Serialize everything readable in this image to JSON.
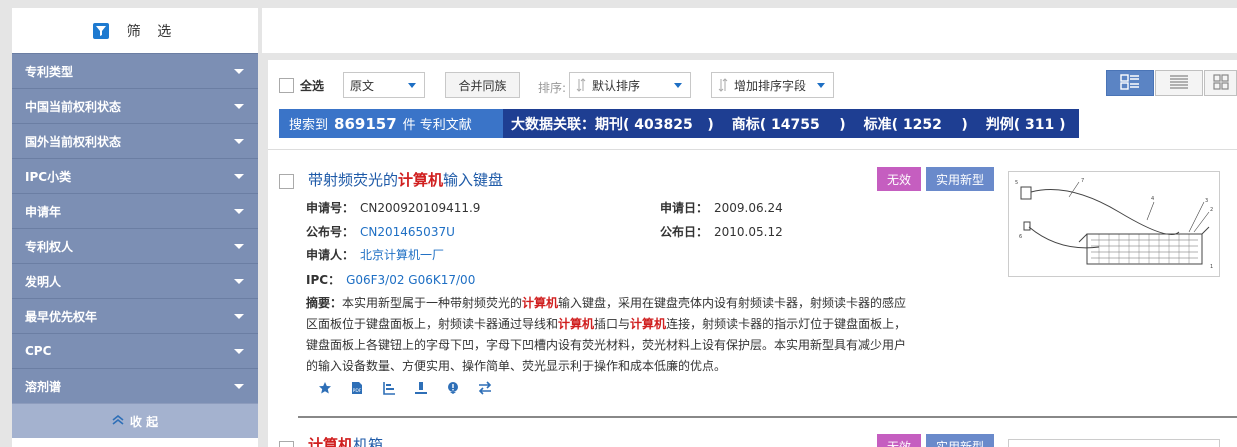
{
  "sidebar": {
    "title": "筛 选",
    "items": [
      {
        "label": "专利类型"
      },
      {
        "label": "中国当前权利状态"
      },
      {
        "label": "国外当前权利状态"
      },
      {
        "label": "IPC小类"
      },
      {
        "label": "申请年"
      },
      {
        "label": "专利权人"
      },
      {
        "label": "发明人"
      },
      {
        "label": "最早优先权年"
      },
      {
        "label": "CPC"
      },
      {
        "label": "溶剂谱"
      }
    ],
    "collapse_label": "收 起"
  },
  "toolbar": {
    "select_all": "全选",
    "text_mode": "原文",
    "merge_family": "合并同族",
    "sort_label": "排序:",
    "sort_value": "默认排序",
    "add_sort_field": "增加排序字段"
  },
  "summary": {
    "prefix": "搜索到",
    "count": "869157",
    "suffix": "件 专利文献",
    "bigdata": "大数据关联：期刊( 403825   )",
    "trademark": "商标( 14755    )",
    "standard": "标准( 1252    )",
    "case": "判例( 311 )"
  },
  "results": [
    {
      "title_pre": "带射频荧光的",
      "title_kw": "计算机",
      "title_post": "输入键盘",
      "status": "无效",
      "type": "实用新型",
      "app_no_label": "申请号：",
      "app_no": "CN200920109411.9",
      "app_date_label": "申请日：",
      "app_date": "2009.06.24",
      "pub_no_label": "公布号：",
      "pub_no": "CN201465037U",
      "pub_date_label": "公布日：",
      "pub_date": "2010.05.12",
      "applicant_label": "申请人：",
      "applicant": "北京计算机一厂",
      "ipc_label": "IPC：",
      "ipc": "G06F3/02 G06K17/00",
      "abstract_label": "摘要：",
      "abstract_1": "本实用新型属于一种带射频荧光的",
      "kw1": "计算机",
      "abstract_2": "输入键盘，采用在键盘壳体内设有射频读卡器，射频读卡器的感应区面板位于键盘面板上，射频读卡器通过导线和",
      "kw2": "计算机",
      "abstract_3": "插口与",
      "kw3": "计算机",
      "abstract_4": "连接，射频读卡器的指示灯位于键盘面板上，键盘面板上各键钮上的字母下凹，字母下凹槽内设有荧光材料，荧光材料上设有保护层。本实用新型具有减少用户的输入设备数量、方便实用、操作简单、荧光显示利于操作和成本低廉的优点。"
    },
    {
      "title_kw": "计算机",
      "title_post": "机箱",
      "status": "无效",
      "type": "实用新型"
    }
  ],
  "colors": {
    "sidebar_item": "#7c8fb4",
    "summary_left": "#3a74c8",
    "summary_right": "#1e3e92",
    "keyword": "#d01f1f",
    "badge_invalid": "#c55ec0",
    "badge_utility": "#6a8acb"
  }
}
